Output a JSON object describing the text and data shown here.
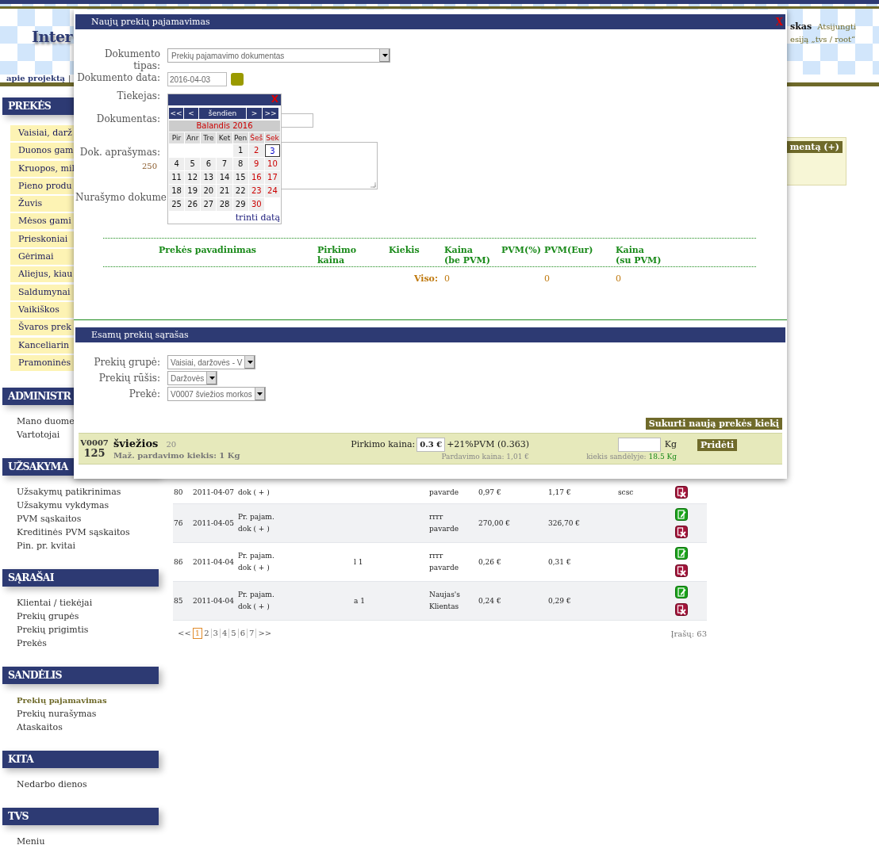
{
  "header": {
    "logo": "Inter",
    "nav_link": "apie projektą",
    "nav_separator": "|",
    "user": "skas",
    "logout": "Atsijungti",
    "session": "esiją „tvs / root“"
  },
  "sidebar": [
    {
      "title": "PREKĖS",
      "kind": "category",
      "items": [
        {
          "label": "Vaisiai, darž",
          "selected": false
        },
        {
          "label": "Duonos gam",
          "selected": false
        },
        {
          "label": "Kruopos, mil",
          "selected": false
        },
        {
          "label": "Pieno produ",
          "selected": false
        },
        {
          "label": "Žuvis",
          "selected": false
        },
        {
          "label": "Mėsos gami",
          "selected": false
        },
        {
          "label": "Prieskoniai",
          "selected": false
        },
        {
          "label": "Gėrimai",
          "selected": false
        },
        {
          "label": "Aliejus, kiau",
          "selected": false
        },
        {
          "label": "Saldumynai",
          "selected": false
        },
        {
          "label": "Vaikiškos",
          "selected": false
        },
        {
          "label": "Švaros prek",
          "selected": false
        },
        {
          "label": "Kanceliarin",
          "selected": false
        },
        {
          "label": "Pramoninės",
          "selected": false
        }
      ]
    },
    {
      "title": "ADMINISTR",
      "kind": "links",
      "items": [
        {
          "label": "Mano duome",
          "selected": false
        },
        {
          "label": "Vartotojai",
          "selected": false
        }
      ]
    },
    {
      "title": "UŽSAKYMA",
      "kind": "links",
      "items": [
        {
          "label": "Užsakymų patikrinimas",
          "selected": false
        },
        {
          "label": "Užsakymu vykdymas",
          "selected": false
        },
        {
          "label": "PVM sąskaitos",
          "selected": false
        },
        {
          "label": "Kreditinės PVM sąskaitos",
          "selected": false
        },
        {
          "label": "Pin. pr. kvitai",
          "selected": false
        }
      ]
    },
    {
      "title": "SĄRAŠAI",
      "kind": "links",
      "items": [
        {
          "label": "Klientai / tiekėjai",
          "selected": false
        },
        {
          "label": "Prekių grupės",
          "selected": false
        },
        {
          "label": "Prekių prigimtis",
          "selected": false
        },
        {
          "label": "Prekės",
          "selected": false
        }
      ]
    },
    {
      "title": "SANDĖLIS",
      "kind": "links",
      "items": [
        {
          "label": "Prekių pajamavimas",
          "selected": true
        },
        {
          "label": "Prekių nurašymas",
          "selected": false
        },
        {
          "label": "Ataskaitos",
          "selected": false
        }
      ]
    },
    {
      "title": "KITA",
      "kind": "links",
      "items": [
        {
          "label": "Nedarbo dienos",
          "selected": false
        }
      ]
    },
    {
      "title": "TVS",
      "kind": "links",
      "items": [
        {
          "label": "Meniu",
          "selected": false
        }
      ]
    }
  ],
  "right_panel": {
    "button": "mentą (+)"
  },
  "table": {
    "rows": [
      {
        "cells": [
          "80",
          "2011-04-07",
          "dok ( + )",
          null,
          "pavarde",
          "0,97 €",
          "1,17 €",
          "scsc"
        ],
        "actions": [
          {
            "kind": "delete"
          }
        ]
      },
      {
        "cells": [
          "76",
          "2011-04-05",
          "Pr. pajam.\ndok ( + )",
          null,
          "rrrr\npavarde",
          "270,00 €",
          "326,70 €",
          null
        ],
        "actions": [
          {
            "kind": "edit"
          },
          {
            "kind": "delete"
          }
        ]
      },
      {
        "cells": [
          "86",
          "2011-04-04",
          "Pr. pajam.\ndok ( + )",
          "l 1",
          "rrrr\npavarde",
          "0,26 €",
          "0,31 €",
          null
        ],
        "actions": [
          {
            "kind": "edit"
          },
          {
            "kind": "delete"
          }
        ]
      },
      {
        "cells": [
          "85",
          "2011-04-04",
          "Pr. pajam.\ndok ( + )",
          "a 1",
          "Naujas's\nKlientas",
          "0,24 €",
          "0,29 €",
          null
        ],
        "actions": [
          {
            "kind": "edit"
          },
          {
            "kind": "delete"
          }
        ]
      }
    ]
  },
  "pagination": {
    "prev": "<<",
    "next": ">>",
    "total": "Įrašų: 63",
    "pages": [
      {
        "label": "1",
        "selected": true
      },
      {
        "label": "2",
        "selected": false
      },
      {
        "label": "3",
        "selected": false
      },
      {
        "label": "4",
        "selected": false
      },
      {
        "label": "5",
        "selected": false
      },
      {
        "label": "6",
        "selected": false
      },
      {
        "label": "7",
        "selected": false
      }
    ]
  },
  "modal": {
    "title": "Naujų prekių pajamavimas",
    "close": "X",
    "fields": [
      {
        "label": "Dokumento tipas:",
        "kind": "select",
        "value": "Prekių pajamavimo dokumentas"
      },
      {
        "label": "Dokumento data:",
        "kind": "date",
        "value": "2016-04-03"
      },
      {
        "label": "Tiekejas:",
        "kind": "label"
      },
      {
        "label": "Dokumentas:",
        "kind": "text"
      },
      {
        "label": "Dok. aprašymas:",
        "kind": "textarea",
        "counter": "250"
      },
      {
        "label": "Nurašymo dokume",
        "kind": "label"
      }
    ],
    "items_table": {
      "columns": [
        "Prekės pavadinimas",
        "Pirkimo\nkaina",
        "Kiekis",
        "Kaina\n(be PVM)",
        "PVM(%)",
        "PVM(Eur)",
        "Kaina\n(su PVM)"
      ],
      "total_label": "Viso:",
      "totals": [
        {
          "kind": "net",
          "value": "0"
        },
        {
          "kind": "vat",
          "value": "0"
        },
        {
          "kind": "gross",
          "value": "0"
        }
      ]
    },
    "catalog": {
      "title": "Esamų prekių sąrašas",
      "filters": [
        {
          "label": "Prekių grupė:",
          "value": "Vaisiai, daržovės - V"
        },
        {
          "label": "Prekių rūšis:",
          "value": "Daržovės"
        },
        {
          "label": "Prekė:",
          "value": "V0007 šviežios morkos"
        }
      ],
      "create_button": "Sukurti naują prekės kiekį",
      "product": {
        "code": "V0007",
        "number": "125",
        "name": "šviežios",
        "count": "20",
        "min_qty": "Maž. pardavimo kiekis: 1 Kg",
        "price_label": "Pirkimo kaina:",
        "price": "0.3 €",
        "vat": "+21%PVM (0.363)",
        "sale_price": "Pardavimo kaina: 1,01 €",
        "unit": "Kg",
        "stock_label": "kiekis sandėlyje:",
        "stock": "18.5 Kg",
        "add_button": "Pridėti"
      }
    }
  },
  "calendar": {
    "close": "X",
    "nav": [
      "<<",
      "<",
      "šendien",
      ">",
      ">>"
    ],
    "month": "Balandis 2016",
    "weekdays": [
      "Pir",
      "Anr",
      "Tre",
      "Ket",
      "Pen",
      "Šeš",
      "Sek"
    ],
    "weeks": [
      [
        {
          "kind": "blank"
        },
        {
          "kind": "blank"
        },
        {
          "kind": "blank"
        },
        {
          "kind": "blank"
        },
        {
          "label": "1",
          "selected": false
        },
        {
          "label": "2",
          "selected": false
        },
        {
          "label": "3",
          "selected": true
        }
      ],
      [
        {
          "label": "4",
          "selected": false
        },
        {
          "label": "5",
          "selected": false
        },
        {
          "label": "6",
          "selected": false
        },
        {
          "label": "7",
          "selected": false
        },
        {
          "label": "8",
          "selected": false
        },
        {
          "label": "9",
          "selected": false
        },
        {
          "label": "10",
          "selected": false
        }
      ],
      [
        {
          "label": "11",
          "selected": false
        },
        {
          "label": "12",
          "selected": false
        },
        {
          "label": "13",
          "selected": false
        },
        {
          "label": "14",
          "selected": false
        },
        {
          "label": "15",
          "selected": false
        },
        {
          "label": "16",
          "selected": false
        },
        {
          "label": "17",
          "selected": false
        }
      ],
      [
        {
          "label": "18",
          "selected": false
        },
        {
          "label": "19",
          "selected": false
        },
        {
          "label": "20",
          "selected": false
        },
        {
          "label": "21",
          "selected": false
        },
        {
          "label": "22",
          "selected": false
        },
        {
          "label": "23",
          "selected": false
        },
        {
          "label": "24",
          "selected": false
        }
      ],
      [
        {
          "label": "25",
          "selected": false
        },
        {
          "label": "26",
          "selected": false
        },
        {
          "label": "27",
          "selected": false
        },
        {
          "label": "28",
          "selected": false
        },
        {
          "label": "29",
          "selected": false
        },
        {
          "label": "30",
          "selected": false
        },
        {
          "kind": "blank"
        }
      ]
    ],
    "clear": "trinti datą"
  }
}
